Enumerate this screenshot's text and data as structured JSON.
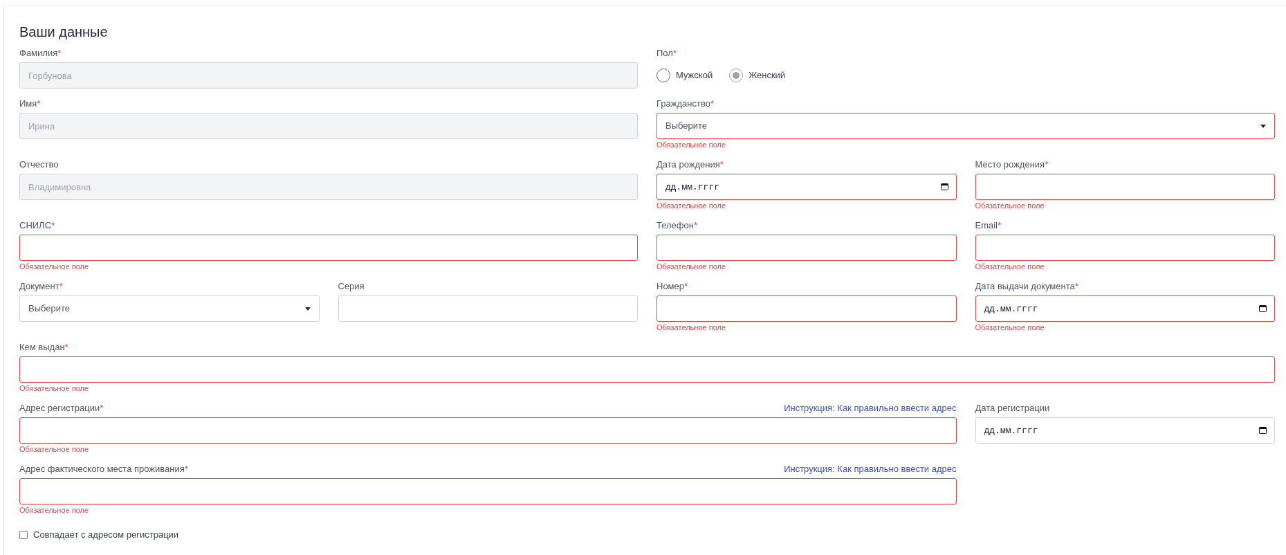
{
  "title": "Ваши данные",
  "rows": [
    [
      {
        "kind": "text",
        "label": "Фамилия",
        "mark": "*",
        "value": "Горбунова",
        "disabled": true
      },
      {
        "kind": "radio",
        "label": "Пол",
        "mark": "*",
        "options": [
          {
            "label": "Мужской",
            "selected": false
          },
          {
            "label": "Женский",
            "selected": true
          }
        ]
      }
    ],
    [
      {
        "kind": "text",
        "label": "Имя",
        "mark": "*",
        "value": "Ирина",
        "disabled": true
      },
      {
        "kind": "select",
        "label": "Гражданство",
        "mark": "*",
        "value": "Выберите",
        "disabled": false,
        "error": "Обязательное поле"
      }
    ],
    [
      {
        "kind": "text",
        "label": "Отчество",
        "value": "Владимировна",
        "disabled": true
      },
      {
        "kind": "date",
        "label": "Дата рождения",
        "mark": "*",
        "placeholder": "дд.мм.гггг",
        "disabled": false,
        "error": "Обязательное поле"
      },
      {
        "kind": "text",
        "label": "Место рождения",
        "mark": "*",
        "disabled": false,
        "error": "Обязательное поле"
      }
    ],
    [
      {
        "kind": "text",
        "label": "СНИЛС",
        "mark": "*",
        "disabled": false,
        "error": "Обязательное поле"
      },
      {
        "kind": "text",
        "label": "Телефон",
        "mark": "*",
        "disabled": false,
        "error": "Обязательное поле"
      },
      {
        "kind": "text",
        "label": "Email",
        "mark": "*",
        "disabled": false,
        "error": "Обязательное поле"
      }
    ],
    [
      {
        "kind": "select",
        "label": "Документ",
        "mark": "*",
        "value": "Выберите",
        "disabled": false
      },
      {
        "kind": "text",
        "label": "Серия",
        "disabled": false
      },
      {
        "kind": "text",
        "label": "Номер",
        "mark": "*",
        "disabled": false,
        "error": "Обязательное поле"
      },
      {
        "kind": "date",
        "label": "Дата выдачи документа",
        "mark": "*",
        "placeholder": "дд.мм.гггг",
        "disabled": false,
        "error": "Обязательное поле"
      }
    ],
    [
      {
        "kind": "text",
        "label": "Кем выдан",
        "mark": "*",
        "disabled": false,
        "error": "Обязательное поле"
      }
    ],
    [
      {
        "kind": "text",
        "label": "Адрес регистрации",
        "mark": "*",
        "link": "Инструкция: Как правильно ввести адрес",
        "disabled": false,
        "error": "Обязательное поле"
      },
      {
        "kind": "date",
        "label": "Дата регистрации",
        "placeholder": "дд.мм.гггг",
        "disabled": false
      }
    ],
    [
      {
        "kind": "text",
        "label": "Адрес фактического места проживания",
        "mark": "*",
        "link": "Инструкция: Как правильно ввести адрес",
        "disabled": false,
        "error": "Обязательное поле"
      }
    ]
  ],
  "same_address": {
    "label": "Совпадает с адресом регистрации",
    "checked": false
  }
}
